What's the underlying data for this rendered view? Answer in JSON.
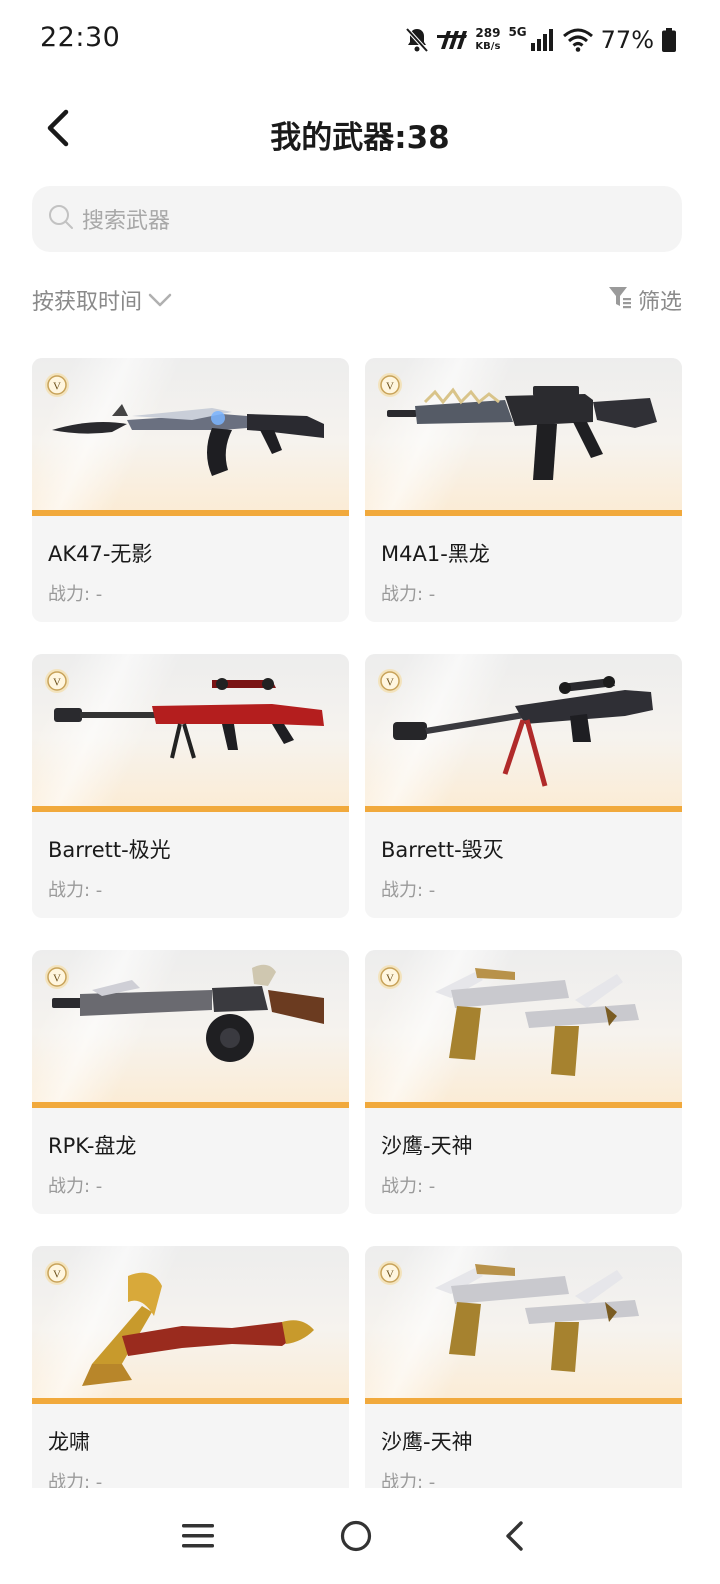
{
  "status_bar": {
    "time": "22:30",
    "speed_value": "289",
    "speed_unit": "KB/s",
    "network": "5G",
    "battery": "77%",
    "icons": [
      "mute-bell-icon",
      "carrier-logo-icon",
      "signal-icon",
      "wifi-icon",
      "battery-icon"
    ]
  },
  "header": {
    "title": "我的武器:38",
    "back_icon": "chevron-left-icon"
  },
  "search": {
    "placeholder": "搜索武器",
    "icon": "search-icon"
  },
  "sort": {
    "label": "按获取时间",
    "icon": "chevron-down-icon"
  },
  "filter": {
    "label": "筛选",
    "icon": "filter-icon"
  },
  "weapons": [
    {
      "name": "AK47-无影",
      "power": "战力: -",
      "art": "rifle-ak"
    },
    {
      "name": "M4A1-黑龙",
      "power": "战力: -",
      "art": "rifle-m4"
    },
    {
      "name": "Barrett-极光",
      "power": "战力: -",
      "art": "sniper-red"
    },
    {
      "name": "Barrett-毁灭",
      "power": "战力: -",
      "art": "sniper-dark"
    },
    {
      "name": "RPK-盘龙",
      "power": "战力: -",
      "art": "lmg-drum"
    },
    {
      "name": "沙鹰-天神",
      "power": "战力: -",
      "art": "dual-pistols"
    },
    {
      "name": "龙啸",
      "power": "战力: -",
      "art": "dragon-axe"
    },
    {
      "name": "沙鹰-天神",
      "power": "战力: -",
      "art": "dual-pistols"
    }
  ],
  "colors": {
    "accent": "#f1a93c",
    "card_bg": "#f5f5f5",
    "muted_text": "#8a8a8a"
  },
  "nav": {
    "icons": [
      "menu-icon",
      "home-icon",
      "back-icon"
    ]
  }
}
